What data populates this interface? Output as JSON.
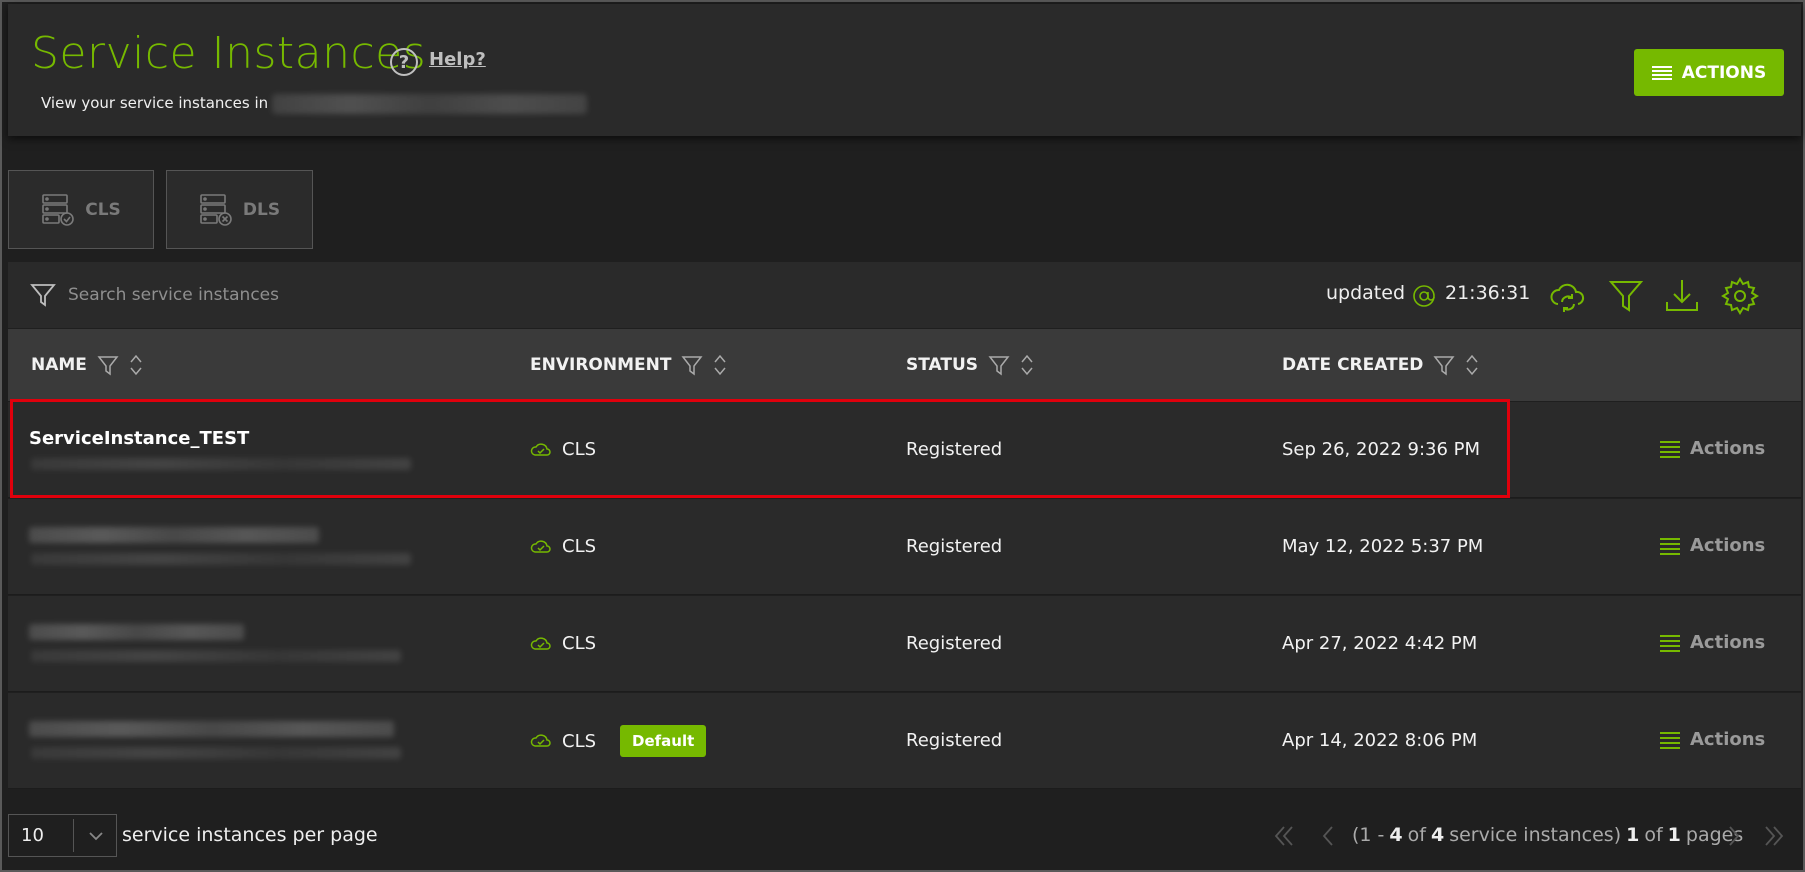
{
  "header": {
    "title": "Service Instances",
    "help_label": "Help?",
    "subtitle": "View your service instances in",
    "actions_label": "ACTIONS"
  },
  "tabs": [
    {
      "label": "CLS"
    },
    {
      "label": "DLS"
    }
  ],
  "toolbar": {
    "search_placeholder": "Search service instances",
    "updated_label": "updated",
    "updated_time": "21:36:31"
  },
  "table": {
    "columns": [
      "NAME",
      "ENVIRONMENT",
      "STATUS",
      "DATE CREATED"
    ],
    "rows": [
      {
        "name": "ServiceInstance_TEST",
        "environment": "CLS",
        "badge": "",
        "status": "Registered",
        "date_created": "Sep 26, 2022 9:36 PM",
        "action": "Actions"
      },
      {
        "name": "",
        "environment": "CLS",
        "badge": "",
        "status": "Registered",
        "date_created": "May 12, 2022 5:37 PM",
        "action": "Actions"
      },
      {
        "name": "",
        "environment": "CLS",
        "badge": "",
        "status": "Registered",
        "date_created": "Apr 27, 2022 4:42 PM",
        "action": "Actions"
      },
      {
        "name": "",
        "environment": "CLS",
        "badge": "Default",
        "status": "Registered",
        "date_created": "Apr 14, 2022 8:06 PM",
        "action": "Actions"
      }
    ]
  },
  "footer": {
    "per_page_value": "10",
    "per_page_label": "service instances per page",
    "range_open": "(1 -",
    "range_end": "4",
    "of_word": "of",
    "total": "4",
    "items_word": "service instances)",
    "page_current": "1",
    "of_word_2": "of",
    "page_total": "1",
    "pages_word": "pages"
  },
  "colors": {
    "accent": "#76b900",
    "highlight": "#e0000c"
  }
}
